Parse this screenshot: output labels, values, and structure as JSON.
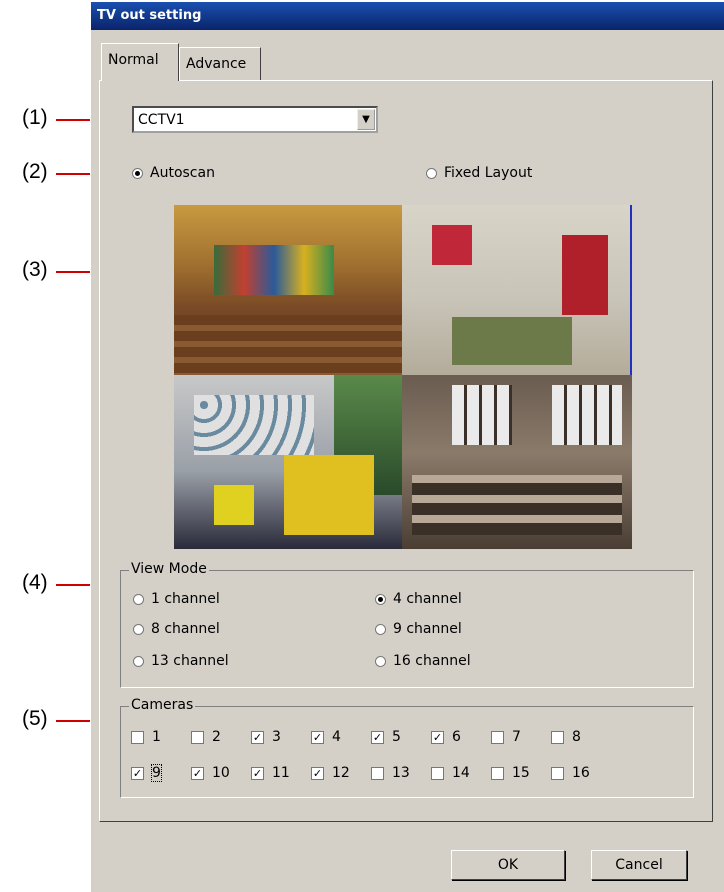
{
  "window": {
    "title": "TV out setting"
  },
  "tabs": [
    {
      "label": "Normal",
      "active": true
    },
    {
      "label": "Advance",
      "active": false
    }
  ],
  "callouts": [
    "(1)",
    "(2)",
    "(3)",
    "(4)",
    "(5)"
  ],
  "source_select": {
    "value": "CCTV1"
  },
  "layout_mode": {
    "autoscan": "Autoscan",
    "fixed": "Fixed Layout",
    "selected": "Autoscan"
  },
  "view_mode": {
    "legend": "View Mode",
    "options": [
      "1 channel",
      "4 channel",
      "8 channel",
      "9 channel",
      "13 channel",
      "16 channel"
    ],
    "selected": "4 channel"
  },
  "cameras": {
    "legend": "Cameras",
    "items": [
      {
        "label": "1",
        "checked": false
      },
      {
        "label": "2",
        "checked": false
      },
      {
        "label": "3",
        "checked": true
      },
      {
        "label": "4",
        "checked": true
      },
      {
        "label": "5",
        "checked": true
      },
      {
        "label": "6",
        "checked": true
      },
      {
        "label": "7",
        "checked": false
      },
      {
        "label": "8",
        "checked": false
      },
      {
        "label": "9",
        "checked": true
      },
      {
        "label": "10",
        "checked": true
      },
      {
        "label": "11",
        "checked": true
      },
      {
        "label": "12",
        "checked": true
      },
      {
        "label": "13",
        "checked": false
      },
      {
        "label": "14",
        "checked": false
      },
      {
        "label": "15",
        "checked": false
      },
      {
        "label": "16",
        "checked": false
      }
    ]
  },
  "buttons": {
    "ok": "OK",
    "cancel": "Cancel"
  },
  "colors": {
    "titlebar": "#0a246a",
    "dialog_bg": "#d4d0c8",
    "callout_line": "#d00000"
  }
}
